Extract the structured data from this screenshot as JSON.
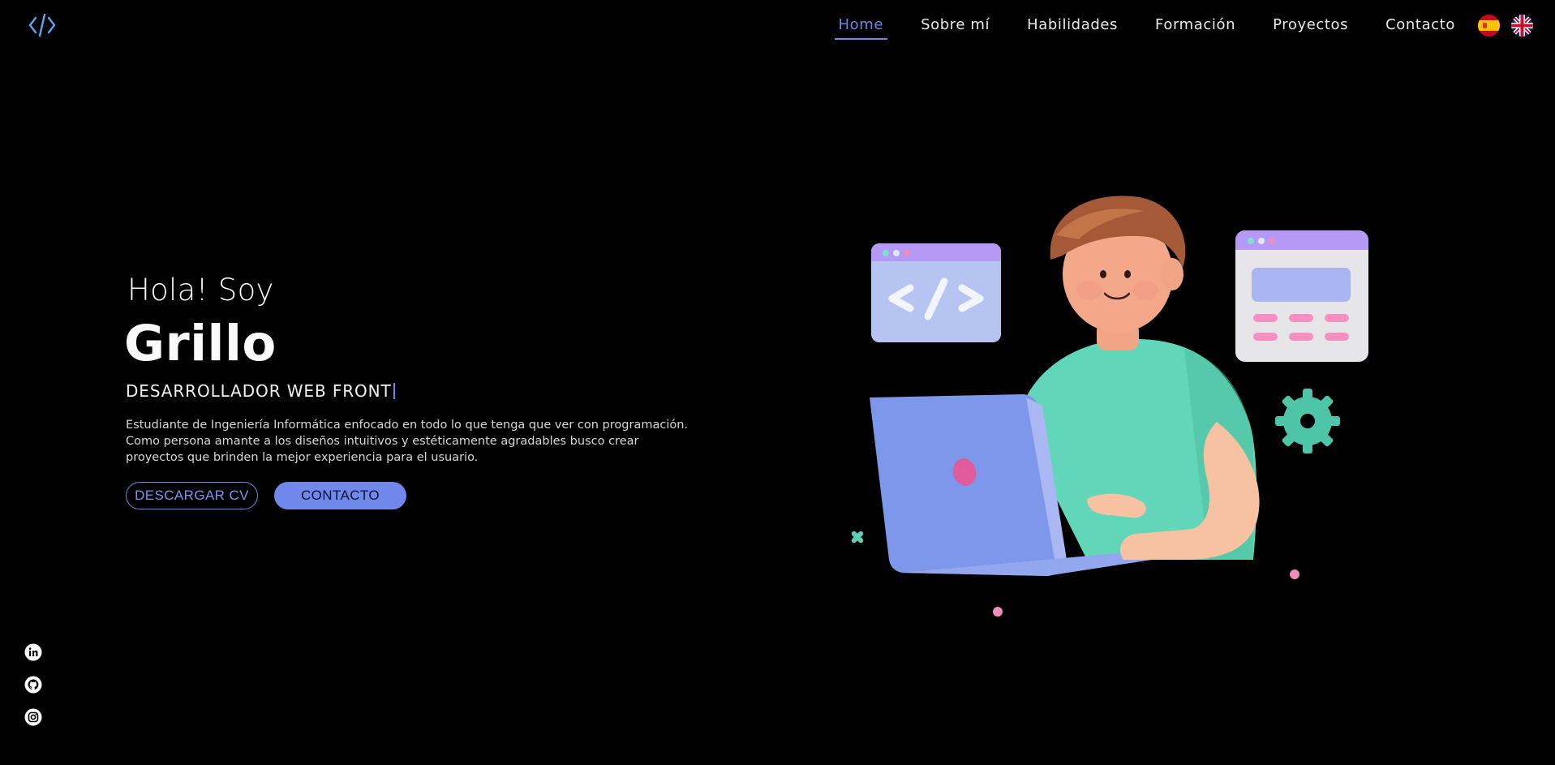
{
  "nav": {
    "items": [
      {
        "label": "Home",
        "active": true
      },
      {
        "label": "Sobre mí",
        "active": false
      },
      {
        "label": "Habilidades",
        "active": false
      },
      {
        "label": "Formación",
        "active": false
      },
      {
        "label": "Proyectos",
        "active": false
      },
      {
        "label": "Contacto",
        "active": false
      }
    ],
    "languages": [
      "es-flag-icon",
      "uk-flag-icon"
    ]
  },
  "hero": {
    "greeting": "Hola! Soy",
    "name": "Grillo",
    "role": "DESARROLLADOR WEB FRONT",
    "description": "Estudiante de Ingeniería Informática enfocado en todo lo que tenga que ver con programación. Como persona amante a los diseños intuitivos y estéticamente agradables busco crear proyectos que brinden la mejor experiencia para el usuario.",
    "cv_button": "DESCARGAR CV",
    "contact_button": "CONTACTO"
  },
  "social": [
    "linkedin-icon",
    "github-icon",
    "instagram-icon"
  ],
  "colors": {
    "accent": "#7088ea",
    "background": "#000000"
  }
}
